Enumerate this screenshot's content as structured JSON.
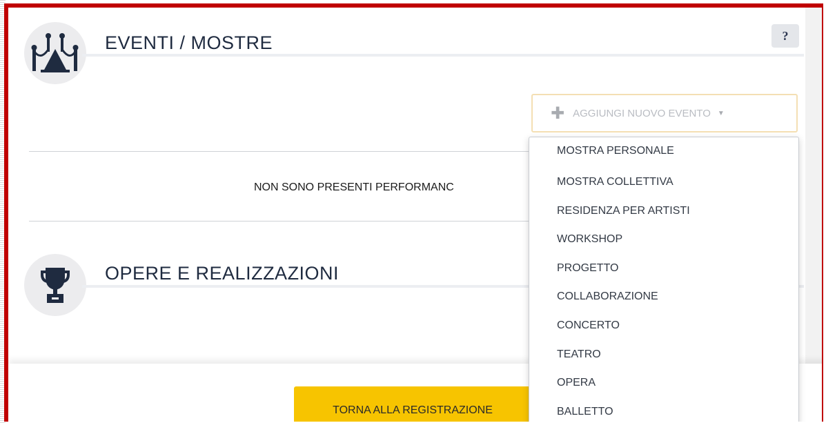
{
  "sections": {
    "events": {
      "title": "EVENTI / MOSTRE",
      "icon": "exhibition-stanchions-icon",
      "help_label": "?",
      "add_button": {
        "icon": "plus-icon",
        "label": "AGGIUNGI NUOVO EVENTO",
        "caret": "caret-down-icon"
      },
      "empty_message": "NON SONO PRESENTI PERFORMANC",
      "dropdown_options": [
        "MOSTRA PERSONALE",
        "MOSTRA COLLETTIVA",
        "RESIDENZA PER ARTISTI",
        "WORKSHOP",
        "PROGETTO",
        "COLLABORAZIONE",
        "CONCERTO",
        "TEATRO",
        "OPERA",
        "BALLETTO"
      ]
    },
    "works": {
      "title": "OPERE E REALIZZAZIONI",
      "icon": "trophy-icon"
    }
  },
  "footer": {
    "back_button": "TORNA ALLA REGISTRAZIONE"
  },
  "colors": {
    "frame": "#c00000",
    "primary_button": "#f7c400",
    "icon_dark": "#1f2b40"
  }
}
